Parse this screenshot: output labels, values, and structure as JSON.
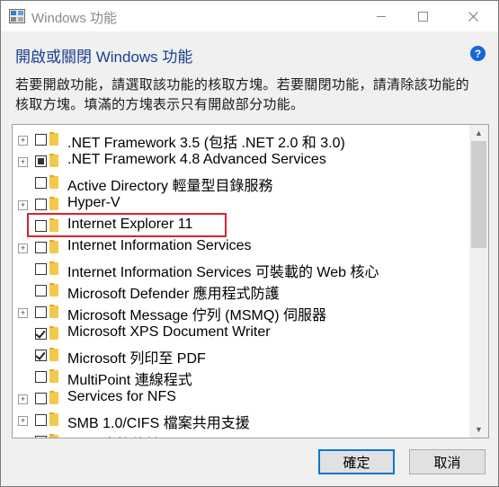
{
  "window": {
    "title": "Windows 功能"
  },
  "header": {
    "title": "開啟或關閉 Windows 功能",
    "description": "若要開啟功能，請選取該功能的核取方塊。若要關閉功能，請清除該功能的核取方塊。填滿的方塊表示只有開啟部分功能。"
  },
  "features": [
    {
      "label": ".NET Framework 3.5 (包括 .NET 2.0 和 3.0)",
      "state": "unchecked",
      "expandable": true
    },
    {
      "label": ".NET Framework 4.8 Advanced Services",
      "state": "partial",
      "expandable": true
    },
    {
      "label": "Active Directory 輕量型目錄服務",
      "state": "unchecked",
      "expandable": false
    },
    {
      "label": "Hyper-V",
      "state": "unchecked",
      "expandable": true
    },
    {
      "label": "Internet Explorer 11",
      "state": "unchecked",
      "expandable": false,
      "highlighted": true
    },
    {
      "label": "Internet Information Services",
      "state": "unchecked",
      "expandable": true
    },
    {
      "label": "Internet Information Services 可裝載的 Web 核心",
      "state": "unchecked",
      "expandable": false
    },
    {
      "label": "Microsoft Defender 應用程式防護",
      "state": "unchecked",
      "expandable": false
    },
    {
      "label": "Microsoft Message 佇列 (MSMQ) 伺服器",
      "state": "unchecked",
      "expandable": true
    },
    {
      "label": "Microsoft XPS Document Writer",
      "state": "checked",
      "expandable": false
    },
    {
      "label": "Microsoft 列印至 PDF",
      "state": "checked",
      "expandable": false
    },
    {
      "label": "MultiPoint 連線程式",
      "state": "unchecked",
      "expandable": false
    },
    {
      "label": "Services for NFS",
      "state": "unchecked",
      "expandable": true
    },
    {
      "label": "SMB 1.0/CIFS 檔案共用支援",
      "state": "unchecked",
      "expandable": true
    },
    {
      "label": "SMB 直接傳輸",
      "state": "checked",
      "expandable": false
    }
  ],
  "buttons": {
    "ok": "確定",
    "cancel": "取消"
  },
  "colors": {
    "highlight": "#d9232a",
    "title": "#1a3d8f",
    "help": "#1467d8",
    "focus": "#0078d7"
  },
  "icons": {
    "app": "windows-features-icon",
    "help": "help-icon",
    "folder": "folder-icon"
  }
}
